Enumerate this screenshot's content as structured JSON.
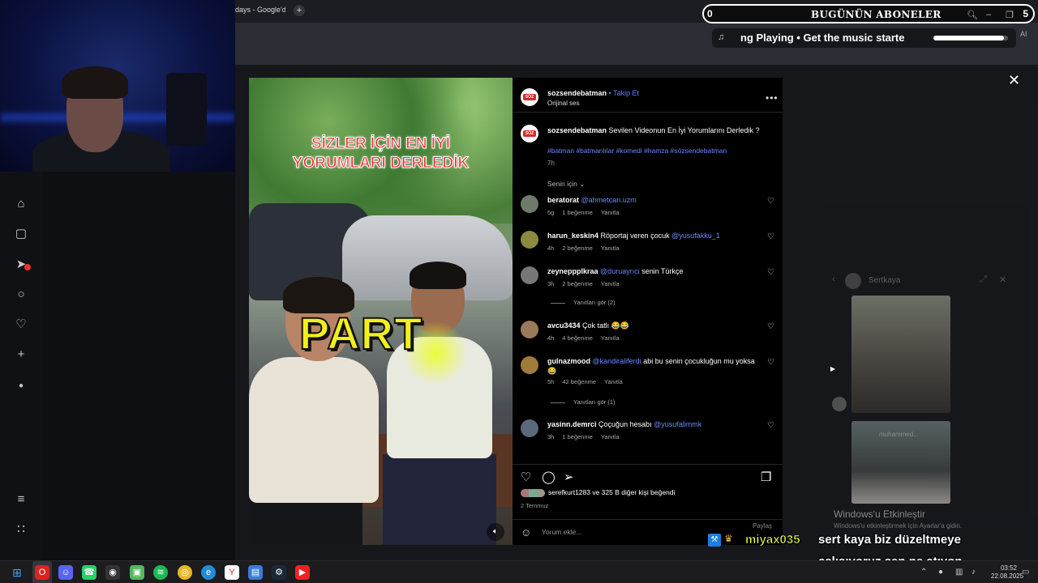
{
  "browser": {
    "tab_title": "days - Google'da",
    "new_tab": "+"
  },
  "subscribers": {
    "count": "0",
    "label": "BUGÜNÜN ABONELER",
    "right_value": "5",
    "icons": [
      "search-icon",
      "minimize-icon",
      "maximize-icon"
    ]
  },
  "now_playing": {
    "text": "ng Playing  •  Get the music starte",
    "progress": 0.95,
    "side_label": "AI"
  },
  "post": {
    "username": "sozsendebatman",
    "follow": "Takip Et",
    "audio": "Orijinal ses",
    "avatar_text": "SÖZ",
    "caption_user": "sozsendebatman",
    "caption_text": "Sevilen Videonun En İyi Yorumlarını Derledik ?",
    "tags": "#batman #batmanlılar #komedi #hamza #sözsendebatman",
    "age": "7h",
    "sort": "Senin için"
  },
  "video": {
    "title_line1": "SİZLER İÇİN EN İYİ",
    "title_line2": "YORUMLARI DERLEDİK",
    "overlay": "PART"
  },
  "comments": [
    {
      "user": "beratorat",
      "mention": "@ahmetcan.uzm",
      "text": "",
      "time": "5g",
      "likes": "1 beğenme",
      "reply": "Yanıtla",
      "color": "#6f7a6a"
    },
    {
      "user": "harun_keskin4",
      "mention": "",
      "text": "Röportaj veren çocuk",
      "mention2": "@yusufakku_1",
      "time": "4h",
      "likes": "2 beğenme",
      "reply": "Yanıtla",
      "color": "#8a8a40"
    },
    {
      "user": "zeyneppplkraa",
      "mention": "@duruayrıci",
      "text": "senin Türkçe",
      "time": "3h",
      "likes": "2 beğenme",
      "reply": "Yanıtla",
      "color": "#77777a",
      "replies": "Yanıtları gör (2)"
    },
    {
      "user": "avcu3434",
      "mention": "",
      "text": "Çok tatlı 😂😂",
      "time": "4h",
      "likes": "4 beğenme",
      "reply": "Yanıtla",
      "color": "#9a7a5a"
    },
    {
      "user": "gulnazmood",
      "mention": "@kandiraliferdi",
      "text": "abi bu senin çocukluğun mu yoksa😂",
      "time": "5h",
      "likes": "42 beğenme",
      "reply": "Yanıtla",
      "color": "#a07a3a",
      "replies": "Yanıtları gör (1)"
    },
    {
      "user": "yasinn.demrci",
      "mention": "",
      "text": "Çoçuğun hesabı",
      "mention2": "@yusufalimmk",
      "time": "3h",
      "likes": "1 beğenme",
      "reply": "Yanıtla",
      "color": "#5a6a7a"
    }
  ],
  "footer": {
    "liked_by": "serefkurt1283 ve 325 B diğer kişi beğendi",
    "date": "2 Temmuz",
    "comment_placeholder": "Yorum ekle...",
    "share": "Paylaş"
  },
  "side_widget": {
    "name": "Sertkaya",
    "thumb_label": "muhammed...",
    "activate_title": "Windows'u Etkinleştir",
    "activate_sub": "Windows'u etkinleştirmek için Ayarlar'a gidin."
  },
  "chat": {
    "user": "miyax035",
    "line1": "sert kaya biz düzeltmeye",
    "line2": "çalışıyoruz sen ne atıyon"
  },
  "taskbar": {
    "time": "03:52",
    "date": "22.08.2025"
  },
  "colors": {
    "accent_link": "#6b87ff",
    "chat_user": "#f4ff4a",
    "video_title": "#ef2b2b",
    "part_text": "#f2f01c"
  }
}
